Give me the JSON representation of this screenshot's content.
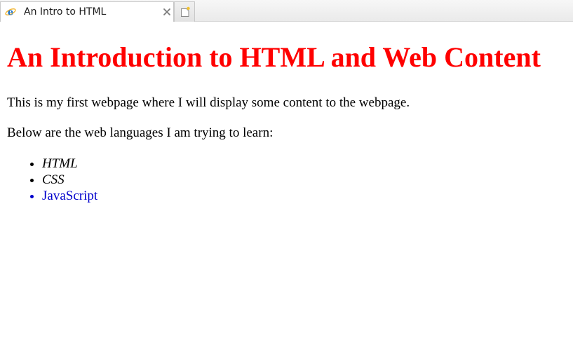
{
  "colors": {
    "heading": "#ff0000",
    "link": "#0000cc",
    "text": "#000000"
  },
  "browser": {
    "tab_title": "An Intro to HTML",
    "tab_icon": "internet-explorer-icon",
    "close_icon": "close-icon",
    "new_tab_icon": "new-tab-icon"
  },
  "page": {
    "heading": "An Introduction to HTML and Web Content",
    "intro": "This is my first webpage where I will display some content to the webpage.",
    "list_intro": "Below are the web languages I am trying to learn:",
    "languages": [
      {
        "label": "HTML",
        "style": "italic"
      },
      {
        "label": "CSS",
        "style": "italic"
      },
      {
        "label": "JavaScript",
        "style": "link"
      }
    ]
  }
}
